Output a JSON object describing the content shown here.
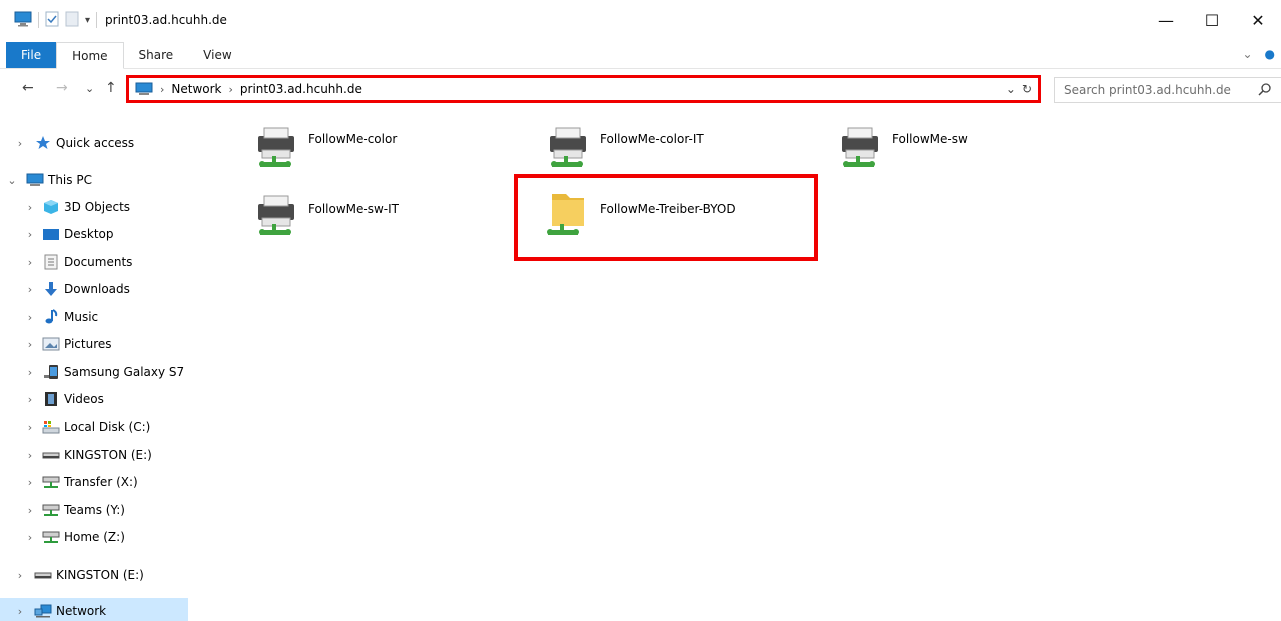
{
  "window": {
    "title": "print03.ad.hcuhh.de",
    "controls": {
      "minimize": "—",
      "maximize": "☐",
      "close": "✕"
    }
  },
  "ribbon": {
    "tabs": [
      {
        "label": "File"
      },
      {
        "label": "Home"
      },
      {
        "label": "Share"
      },
      {
        "label": "View"
      }
    ]
  },
  "nav": {
    "back": "←",
    "forward": "→",
    "recent": "⌄",
    "up": "↑",
    "breadcrumb": [
      "Network",
      "print03.ad.hcuhh.de"
    ],
    "search_placeholder": "Search print03.ad.hcuhh.de"
  },
  "sidebar": {
    "items": [
      {
        "label": "Quick access",
        "icon": "star-icon"
      },
      {
        "label": "This PC",
        "icon": "pc-icon"
      },
      {
        "label": "3D Objects",
        "icon": "cube-icon"
      },
      {
        "label": "Desktop",
        "icon": "desktop-icon"
      },
      {
        "label": "Documents",
        "icon": "document-icon"
      },
      {
        "label": "Downloads",
        "icon": "download-icon"
      },
      {
        "label": "Music",
        "icon": "music-icon"
      },
      {
        "label": "Pictures",
        "icon": "pictures-icon"
      },
      {
        "label": "Samsung Galaxy S7",
        "icon": "phone-icon"
      },
      {
        "label": "Videos",
        "icon": "videos-icon"
      },
      {
        "label": "Local Disk (C:)",
        "icon": "disk-icon"
      },
      {
        "label": "KINGSTON (E:)",
        "icon": "usb-drive-icon"
      },
      {
        "label": "Transfer (X:)",
        "icon": "network-drive-icon"
      },
      {
        "label": "Teams (Y:)",
        "icon": "network-drive-icon"
      },
      {
        "label": "Home (Z:)",
        "icon": "network-drive-icon"
      },
      {
        "label": "KINGSTON (E:)",
        "icon": "usb-drive-icon"
      },
      {
        "label": "Network",
        "icon": "network-icon"
      }
    ]
  },
  "content": {
    "items": [
      {
        "label": "FollowMe-color",
        "type": "printer"
      },
      {
        "label": "FollowMe-color-IT",
        "type": "printer"
      },
      {
        "label": "FollowMe-sw",
        "type": "printer"
      },
      {
        "label": "FollowMe-sw-IT",
        "type": "printer"
      },
      {
        "label": "FollowMe-Treiber-BYOD",
        "type": "shared-folder"
      }
    ]
  },
  "colors": {
    "accent": "#1979ca",
    "highlight": "#f00000",
    "selection": "#cce8ff",
    "printer_green": "#4caf50",
    "folder_yellow": "#f4c542"
  }
}
